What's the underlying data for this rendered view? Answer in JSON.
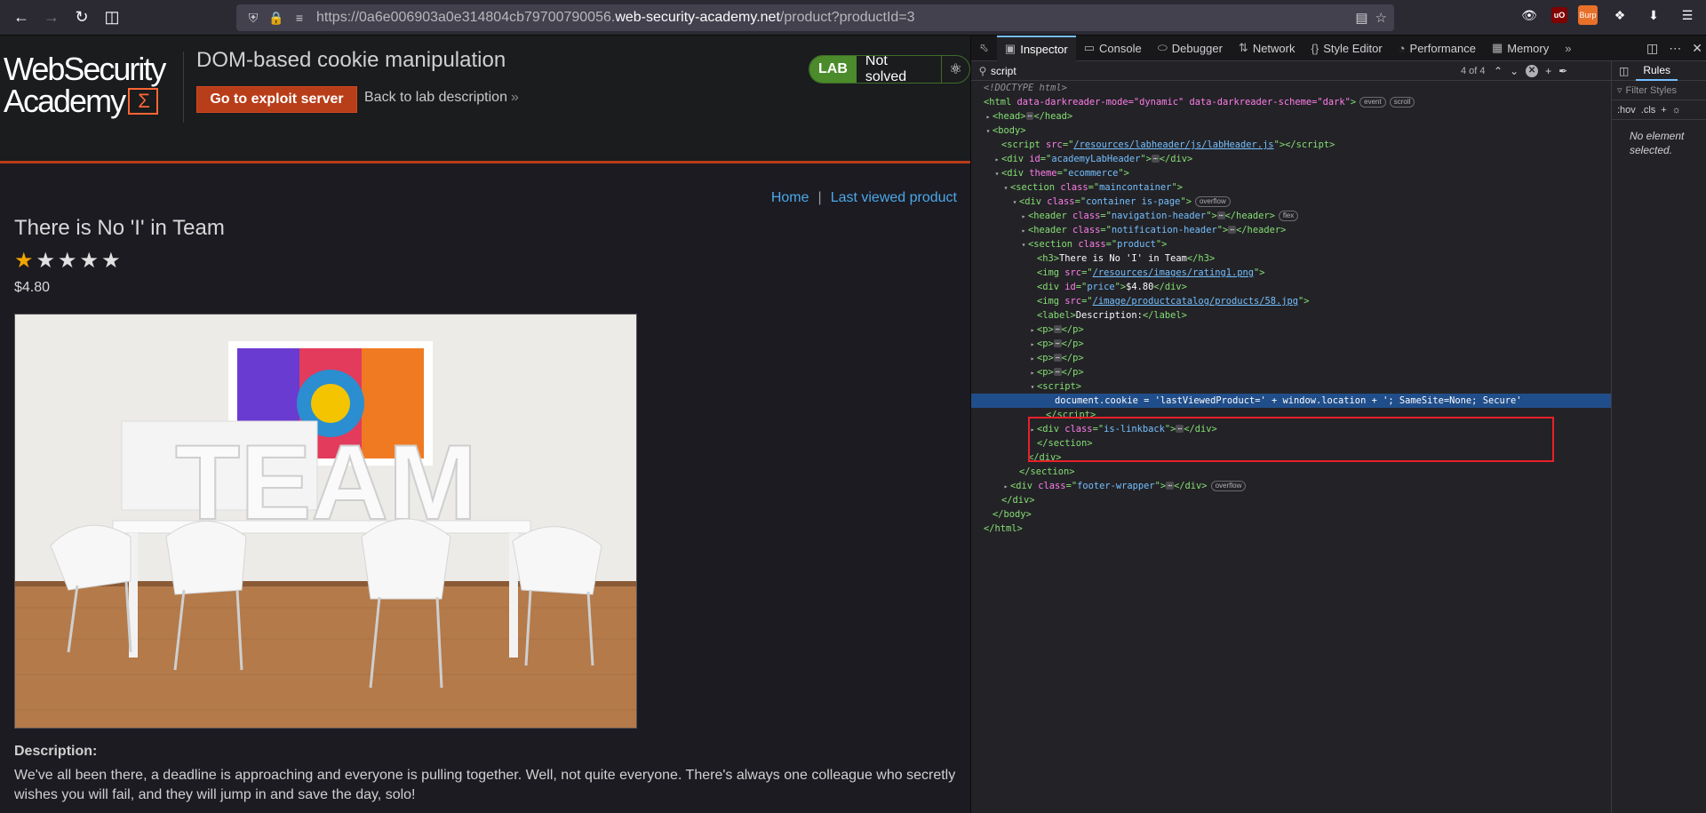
{
  "browser": {
    "url_prefix": "https://0a6e006903a0e314804cb79700790056.",
    "url_host": "web-security-academy.net",
    "url_path": "/product?productId=3",
    "burp_label": "Burp"
  },
  "lab": {
    "logo_line1": "WebSecurity",
    "logo_line2": "Academy",
    "title": "DOM-based cookie manipulation",
    "exploit_button": "Go to exploit server",
    "back_link": "Back to lab description",
    "badge": "LAB",
    "status": "Not solved"
  },
  "nav": {
    "home": "Home",
    "separator": "|",
    "last_viewed": "Last viewed product"
  },
  "product": {
    "title": "There is No 'I' in Team",
    "rating": 1,
    "rating_max": 5,
    "price": "$4.80",
    "image_text": "TEAM",
    "description_label": "Description:",
    "description": "We've all been there, a deadline is approaching and everyone is pulling together. Well, not quite everyone. There's always one colleague who secretly wishes you will fail, and they will jump in and save the day, solo!"
  },
  "devtools": {
    "tabs": [
      {
        "label": "Inspector",
        "icon": "inspector-icon"
      },
      {
        "label": "Console",
        "icon": "console-icon"
      },
      {
        "label": "Debugger",
        "icon": "debugger-icon"
      },
      {
        "label": "Network",
        "icon": "network-icon"
      },
      {
        "label": "Style Editor",
        "icon": "style-editor-icon"
      },
      {
        "label": "Performance",
        "icon": "performance-icon"
      },
      {
        "label": "Memory",
        "icon": "memory-icon"
      }
    ],
    "search_value": "script",
    "search_count": "4 of 4",
    "rules_tab": "Rules",
    "filter_placeholder": "Filter Styles",
    "hov": ":hov",
    "cls": ".cls",
    "no_element": "No element selected.",
    "markup": {
      "doctype": "<!DOCTYPE html>",
      "html_attrs": "data-darkreader-mode=\"dynamic\" data-darkreader-scheme=\"dark\"",
      "badge_event": "event",
      "badge_scroll": "scroll",
      "badge_overflow": "overflow",
      "badge_flex": "flex",
      "labheader_src": "/resources/labheader/js/labHeader.js",
      "lab_header_id": "academyLabHeader",
      "theme": "ecommerce",
      "maincontainer": "maincontainer",
      "container_class": "container is-page",
      "nav_header": "navigation-header",
      "notif_header": "notification-header",
      "section_product": "product",
      "h3_text": "There is No 'I' in Team",
      "rating_src": "/resources/images/rating1.png",
      "price_id": "price",
      "price_text": "$4.80",
      "product_img_src": "/image/productcatalog/products/58.jpg",
      "label_text": "Description:",
      "script_code": "document.cookie = 'lastViewedProduct=' + window.location + '; SameSite=None; Secure'",
      "linkback": "is-linkback",
      "footer": "footer-wrapper"
    }
  }
}
